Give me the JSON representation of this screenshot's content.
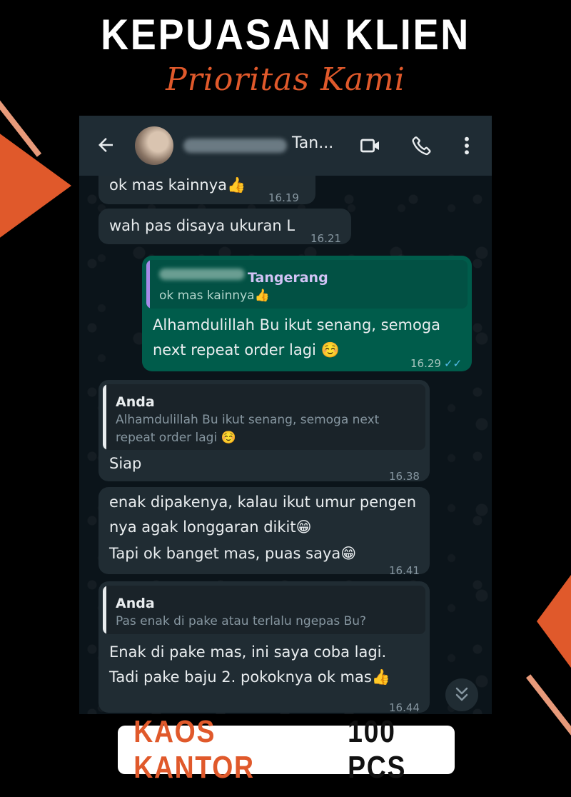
{
  "poster": {
    "headline": "KEPUASAN KLIEN",
    "subheadline": "Prioritas Kami",
    "badge_product": "KAOS KANTOR",
    "badge_qty": "100 PCS"
  },
  "colors": {
    "accent": "#e0592b",
    "incoming_bubble": "#202c33",
    "outgoing_bubble": "#005c4b",
    "chat_background": "#0b141a",
    "header": "#1f2c34",
    "read_ticks": "#53bdeb"
  },
  "header": {
    "contact_name": "Tan...",
    "icons": [
      "back-arrow-icon",
      "video-call-icon",
      "voice-call-icon",
      "more-options-icon"
    ]
  },
  "messages": [
    {
      "direction": "incoming",
      "lines": [
        "ok mas kainnya👍"
      ],
      "time": "16.19"
    },
    {
      "direction": "incoming",
      "lines": [
        "wah pas disaya ukuran L"
      ],
      "time": "16.21"
    },
    {
      "direction": "outgoing",
      "quote": {
        "name": "Tangerang",
        "text": "ok mas kainnya👍"
      },
      "lines": [
        "Alhamdulillah Bu ikut senang, semoga",
        "next repeat order lagi ☺️"
      ],
      "time": "16.29",
      "ticks": "✓✓"
    },
    {
      "direction": "incoming",
      "quote": {
        "name": "Anda",
        "text_lines": [
          "Alhamdulillah Bu ikut senang, semoga next",
          "repeat order lagi ☺️"
        ]
      },
      "lines": [
        "Siap"
      ],
      "time": "16.38"
    },
    {
      "direction": "incoming",
      "lines": [
        "enak dipakenya, kalau ikut umur pengen",
        "nya agak longgaran dikit😁",
        "Tapi ok banget mas,  puas saya😁"
      ],
      "time": "16.41"
    },
    {
      "direction": "incoming",
      "quote": {
        "name": "Anda",
        "text": "Pas enak di pake atau terlalu ngepas Bu?"
      },
      "lines": [
        "Enak di pake mas, ini saya coba lagi.",
        "Tadi pake baju 2. pokoknya ok mas👍"
      ],
      "time": "16.44"
    }
  ]
}
